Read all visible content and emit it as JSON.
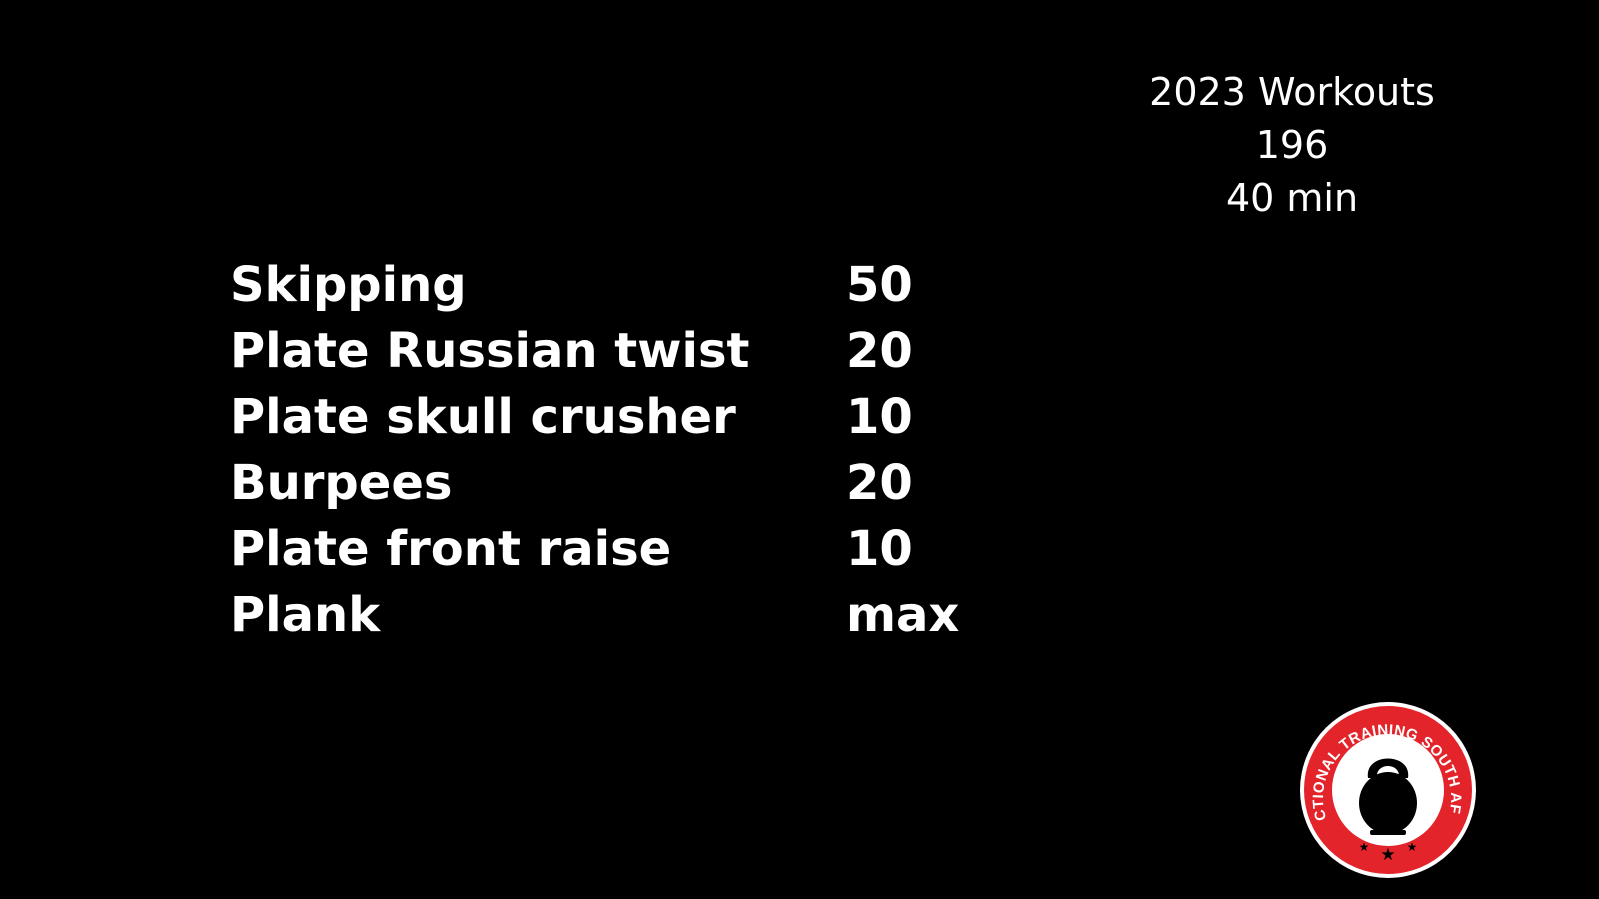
{
  "header": {
    "title": "2023 Workouts",
    "number": "196",
    "duration": "40 min"
  },
  "workout": {
    "exercises": [
      {
        "name": "Skipping",
        "reps": "50"
      },
      {
        "name": "Plate Russian twist",
        "reps": "20"
      },
      {
        "name": "Plate skull crusher",
        "reps": "10"
      },
      {
        "name": "Burpees",
        "reps": "20"
      },
      {
        "name": "Plate front raise",
        "reps": "10"
      },
      {
        "name": "Plank",
        "reps": "max"
      }
    ]
  },
  "logo": {
    "text": "FUNCTIONAL TRAINING SOUTH AFRICA",
    "icon": "kettlebell-icon",
    "colors": {
      "ring": "#e3242b",
      "inner": "#ffffff",
      "kettlebell": "#000000"
    }
  },
  "colors": {
    "background": "#000000",
    "text": "#ffffff"
  }
}
